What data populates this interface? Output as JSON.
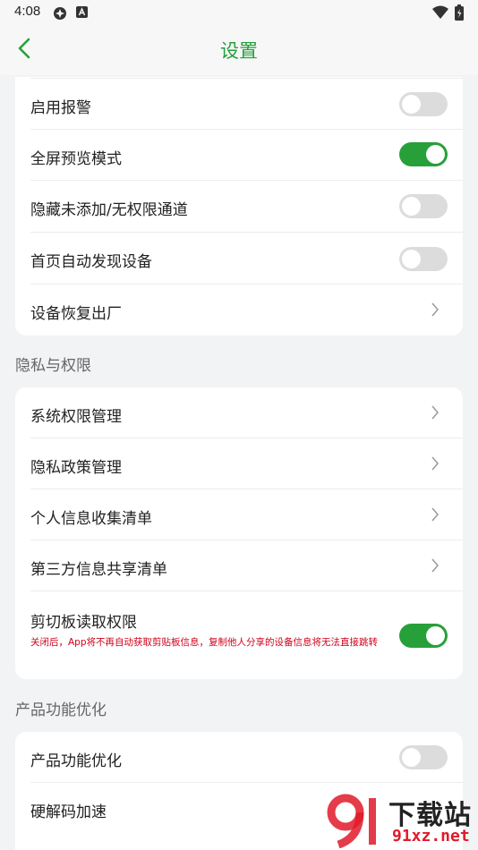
{
  "status_bar": {
    "time": "4:08"
  },
  "header": {
    "title": "设置"
  },
  "card1": [
    {
      "label": "启用报警",
      "control": "toggle",
      "on": false
    },
    {
      "label": "全屏预览模式",
      "control": "toggle",
      "on": true
    },
    {
      "label": "隐藏未添加/无权限通道",
      "control": "toggle",
      "on": false
    },
    {
      "label": "首页自动发现设备",
      "control": "toggle",
      "on": false
    },
    {
      "label": "设备恢复出厂",
      "control": "chevron"
    }
  ],
  "section_privacy": {
    "title": "隐私与权限"
  },
  "card2": [
    {
      "label": "系统权限管理",
      "control": "chevron"
    },
    {
      "label": "隐私政策管理",
      "control": "chevron"
    },
    {
      "label": "个人信息收集清单",
      "control": "chevron"
    },
    {
      "label": "第三方信息共享清单",
      "control": "chevron"
    },
    {
      "label": "剪切板读取权限",
      "control": "toggle",
      "on": true,
      "note": "关闭后，App将不再自动获取剪贴板信息，复制他人分享的设备信息将无法直接跳转"
    }
  ],
  "section_product": {
    "title": "产品功能优化"
  },
  "card3": [
    {
      "label": "产品功能优化",
      "control": "toggle",
      "on": false
    },
    {
      "label": "硬解码加速",
      "control": "toggle",
      "on": false
    }
  ],
  "watermark": {
    "text": "下载站",
    "url": "91xz.net"
  },
  "colors": {
    "accent": "#27a03a",
    "toggle_off": "#dcdcdc",
    "note": "#d0001a",
    "background": "#f2f3f5"
  }
}
